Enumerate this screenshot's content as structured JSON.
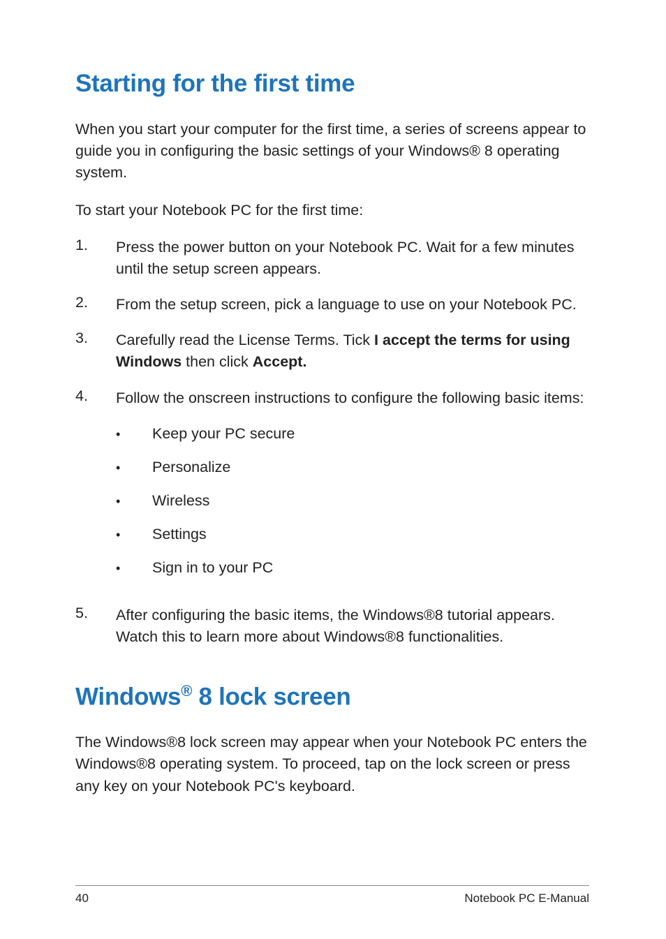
{
  "section1": {
    "heading": "Starting for the first time",
    "intro": "When you start your computer for the first time, a series of screens appear to guide you in configuring the basic settings of your Windows® 8 operating system.",
    "lead": "To start your Notebook PC for the first time:",
    "steps": [
      {
        "num": "1.",
        "text": "Press the power button on your Notebook PC. Wait for a few minutes until the setup screen appears."
      },
      {
        "num": "2.",
        "text": "From the setup screen, pick a language to use on your Notebook PC."
      },
      {
        "num": "3.",
        "pre": "Carefully read the License Terms. Tick ",
        "bold1": "I accept the terms for using Windows",
        "mid": " then click ",
        "bold2": "Accept."
      },
      {
        "num": "4.",
        "text": "Follow the onscreen instructions to configure the following basic items:",
        "subitems": [
          "Keep your PC secure",
          "Personalize",
          "Wireless",
          "Settings",
          "Sign in to your PC"
        ]
      },
      {
        "num": "5.",
        "text": "After configuring the basic items, the Windows®8 tutorial appears. Watch this to learn more about Windows®8 functionalities."
      }
    ]
  },
  "section2": {
    "heading_pre": "Windows",
    "heading_reg": "®",
    "heading_post": " 8 lock screen",
    "body": "The Windows®8 lock screen may appear when your Notebook PC enters the Windows®8 operating system. To proceed,  tap on the lock screen or press any key on your Notebook PC's keyboard."
  },
  "footer": {
    "page": "40",
    "title": "Notebook PC E-Manual"
  }
}
